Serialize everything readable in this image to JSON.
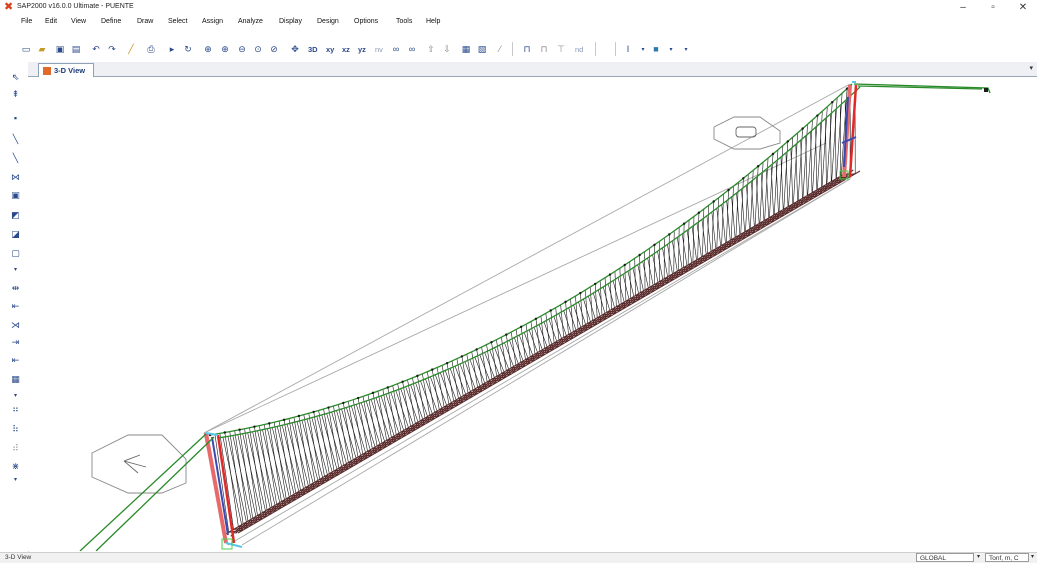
{
  "window": {
    "title": "SAP2000 v16.0.0 Ultimate  - PUENTE",
    "app_icon": "sap2000-logo-icon",
    "minimize": "–",
    "maximize": "▫",
    "close": "✕"
  },
  "menu": [
    "File",
    "Edit",
    "View",
    "Define",
    "Draw",
    "Select",
    "Assign",
    "Analyze",
    "Display",
    "Design",
    "Options",
    "Tools",
    "Help"
  ],
  "toolbar": {
    "icons": [
      "new-file-icon",
      "open-folder-icon",
      "save-icon",
      "save-as-icon",
      "undo-icon",
      "redo-icon",
      "pencil-icon",
      "print-icon",
      "run-analysis-icon",
      "rotate-icon",
      "zoom-window-icon",
      "zoom-in-icon",
      "zoom-out-icon",
      "zoom-restore-icon",
      "zoom-previous-icon",
      "pan-icon"
    ],
    "view_3d": "3D",
    "view_xy": "xy",
    "view_xz": "xz",
    "view_yz": "yz",
    "view_nv": "nv",
    "right_icons": [
      "move-up-icon",
      "move-down-icon",
      "display-options-icon",
      "show-undeformed-icon",
      "section-cut-icon",
      "frame-icon",
      "quick-draw-icon",
      "node-icon",
      "steel-section-icon",
      "color-icon"
    ],
    "nd_label": "nd"
  },
  "left_toolbar": [
    "pointer-icon",
    "reshape-icon",
    "draw-joint-icon",
    "draw-frame-icon",
    "quick-frame-icon",
    "draw-cable-icon",
    "draw-link-icon",
    "draw-area-icon",
    "quick-area-icon",
    "draw-solid-icon",
    "more-icon",
    "select-all-icon",
    "select-previous-icon",
    "clear-selection-icon",
    "intersecting-line-icon",
    "restraint-icon",
    "grid-icon",
    "snap-points-icon",
    "snap-ends-icon",
    "snap-intersect-icon",
    "snap-perpendicular-icon"
  ],
  "tab": {
    "label": "3-D View",
    "dropdown_arrow": "▾"
  },
  "status": {
    "view_name": "3-D View",
    "coord_system": "GLOBAL",
    "units": "Tonf, m, C"
  },
  "colors": {
    "cable": "#2a8a2a",
    "hanger": "#1a1a1a",
    "deck": "#5a2a2a",
    "tower_red": "#e02a2a",
    "tower_blue": "#3a4ab0",
    "outline": "#a8a8a8"
  }
}
